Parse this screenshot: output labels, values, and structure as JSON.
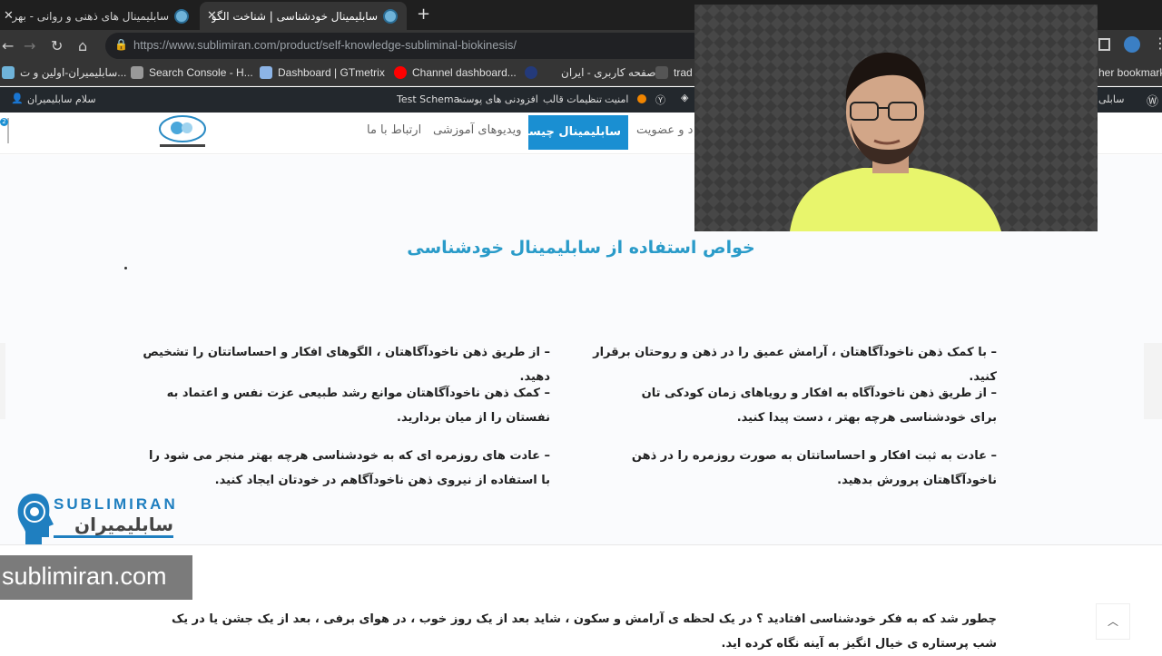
{
  "browser": {
    "tabs": [
      {
        "title": "سابلیمینال های ذهنی و روانی - بهر"
      },
      {
        "title": "سابلیمینال خودشناسی | شناخت الگو"
      }
    ],
    "url_host": "https://www.sublimiran.com",
    "url_path": "/product/self-knowledge-subliminal-biokinesis/",
    "bookmarks": [
      {
        "label": "سابلیمیران-اولین و ت..."
      },
      {
        "label": "Search Console - H..."
      },
      {
        "label": "Dashboard | GTmetrix"
      },
      {
        "label": "Channel dashboard..."
      },
      {
        "label": "صفحه کاربری - ایران..."
      },
      {
        "label": "trad"
      },
      {
        "label": "her bookmark"
      }
    ],
    "colors": {
      "chrome": "#353535",
      "tabbar": "#1f1f1f"
    }
  },
  "adminbar": {
    "greeting": "سلام سابلیمیران",
    "items": [
      "Test Schema",
      "افزودنی های پوسته",
      "تنظیمات قالب",
      "امنیت"
    ],
    "right_label": "سابلی"
  },
  "sitenav": {
    "items": [
      "د و عضویت",
      "سابلیمینال چیست",
      "ویدیوهای آموزشی",
      "ارتباط با ما"
    ],
    "badge": "2",
    "accent": "#1a8fd2"
  },
  "content": {
    "title": "خواص استفاده از سابلیمینال خودشناسی",
    "right_column": [
      "– با کمک ذهن ناخودآگاهتان ، آرامش عمیق را در ذهن و روحتان برقرار کنید.",
      "– از طریق ذهن ناخودآگاه به افکار و رویاهای زمان کودکی تان برای خودشناسی هرچه بهتر ، دست پیدا کنید.",
      "– عادت به ثبت افکار و احساساتتان به صورت روزمره را در ذهن ناخودآگاهتان پرورش بدهید."
    ],
    "left_column": [
      "– از طریق ذهن ناخودآگاهتان ، الگوهای افکار و احساساتتان را تشخیص دهید.",
      "– کمک ذهن ناخودآگاهتان موانع رشد طبیعی عزت نفس و اعتماد به نفستان را از میان بردارید.",
      "– عادت های روزمره ای که به خودشناسی هرچه بهتر منجر می شود را با استفاده از نیروی ذهن ناخودآگاهم در خودتان ایجاد کنید."
    ],
    "bottom": "چطور شد که به فکر خودشناسی افتادید ؟ در یک لحظه ی آرامش و سکون ، شاید بعد از یک روز خوب ، در هوای برفی ، بعد از یک جشن یا در یک شب پرستاره ی خیال انگیز به آینه نگاه کرده اید."
  },
  "overlay": {
    "watermark_en": "SUBLIMIRAN",
    "watermark_fa": "سابلیمیران",
    "domain": "sublimiran.com"
  }
}
